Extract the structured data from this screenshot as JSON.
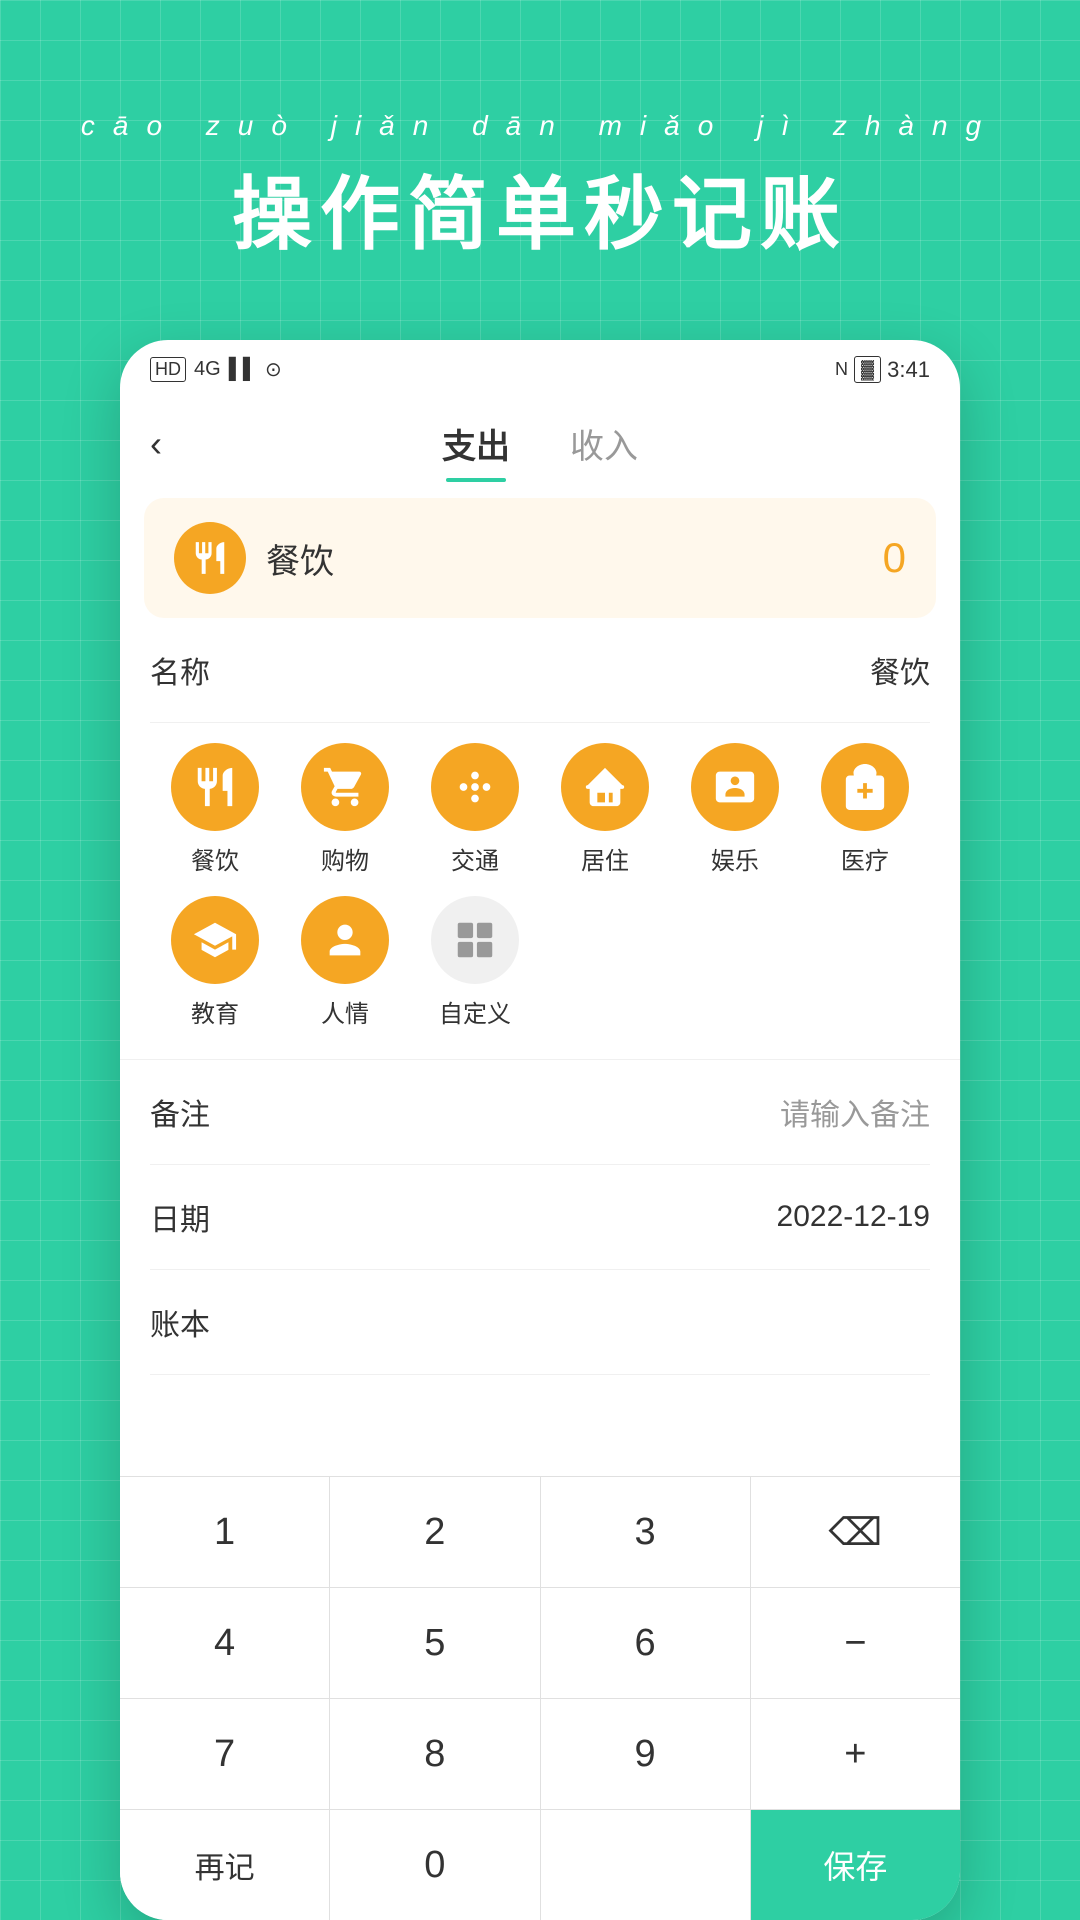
{
  "header": {
    "pinyin": "cāo  zuò  jiǎn  dān  miǎo  jì  zhàng",
    "title": "操作简单秒记账"
  },
  "statusBar": {
    "left": "HD  4G  ▌▌  ⊙",
    "time": "3:41"
  },
  "tabs": {
    "back": "‹",
    "expense": "支出",
    "income": "收入"
  },
  "amountDisplay": {
    "category": "餐饮",
    "amount": "0"
  },
  "formRows": {
    "nameLabel": "名称",
    "nameValue": "餐饮",
    "remarkLabel": "备注",
    "remarkPlaceholder": "请输入备注",
    "dateLabel": "日期",
    "dateValue": "2022-12-19",
    "bookLabel": "账本",
    "bookValue": ""
  },
  "categories": [
    {
      "id": "food",
      "label": "餐饮",
      "icon": "food",
      "active": true
    },
    {
      "id": "shopping",
      "label": "购物",
      "icon": "shopping",
      "active": false
    },
    {
      "id": "transport",
      "label": "交通",
      "icon": "transport",
      "active": false
    },
    {
      "id": "housing",
      "label": "居住",
      "icon": "housing",
      "active": false
    },
    {
      "id": "entertainment",
      "label": "娱乐",
      "icon": "entertainment",
      "active": false
    },
    {
      "id": "medical",
      "label": "医疗",
      "icon": "medical",
      "active": false
    },
    {
      "id": "education",
      "label": "教育",
      "icon": "education",
      "active": false
    },
    {
      "id": "social",
      "label": "人情",
      "icon": "social",
      "active": false
    },
    {
      "id": "custom",
      "label": "自定义",
      "icon": "custom",
      "active": false,
      "gray": true
    }
  ],
  "numpad": {
    "rows": [
      [
        "1",
        "2",
        "3",
        "⌫"
      ],
      [
        "4",
        "5",
        "6",
        "−"
      ],
      [
        "7",
        "8",
        "9",
        "+"
      ],
      [
        "再记",
        "0",
        "",
        "保存"
      ]
    ]
  }
}
